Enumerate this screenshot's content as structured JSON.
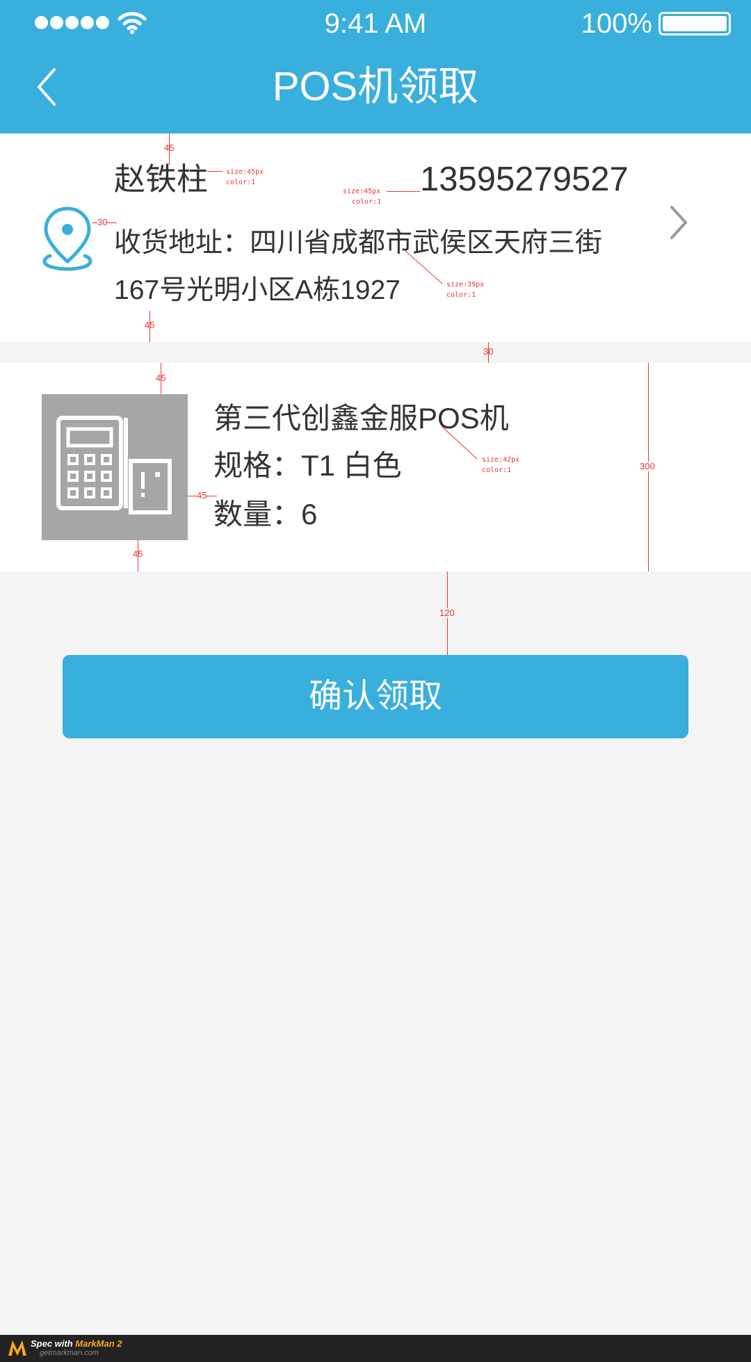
{
  "status_bar": {
    "time": "9:41 AM",
    "battery": "100%",
    "battery_level": 1.0
  },
  "nav": {
    "title": "POS机领取",
    "back_icon": "chevron-left-icon"
  },
  "address": {
    "recipient": "赵铁柱",
    "phone": "13595279527",
    "address_text": "收货地址：四川省成都市武侯区天府三街167号光明小区A栋1927",
    "location_icon": "map-pin-icon",
    "chevron_icon": "chevron-right-icon"
  },
  "product": {
    "name": "第三代创鑫金服POS机",
    "spec": "规格：T1  白色",
    "quantity": "数量：6",
    "image_icon": "pos-terminal-icon"
  },
  "confirm_button": "确认领取",
  "annotations": {
    "recipient_font": "size:45px",
    "recipient_color": "color:1",
    "phone_font": "size:45px",
    "phone_color": "color:1",
    "address_font": "size:39px",
    "address_color": "color:1",
    "product_font": "size:42px",
    "product_color": "color:1",
    "dim_header_gap": "45",
    "dim_icon_gap": "30",
    "dim_addr_bottom": "45",
    "dim_divider": "30",
    "dim_product_top": "45",
    "dim_img_text_gap": "45",
    "dim_product_bottom": "45",
    "dim_card_height": "300",
    "dim_button_gap": "120"
  },
  "footer_badge": {
    "line1_prefix": "Spec with ",
    "line1_brand": "MarkMan 2",
    "line2": "getmarkman.com"
  },
  "colors": {
    "primary": "#38afdc",
    "text": "#333333",
    "background": "#f4f4f4",
    "annotation": "#e33333"
  }
}
